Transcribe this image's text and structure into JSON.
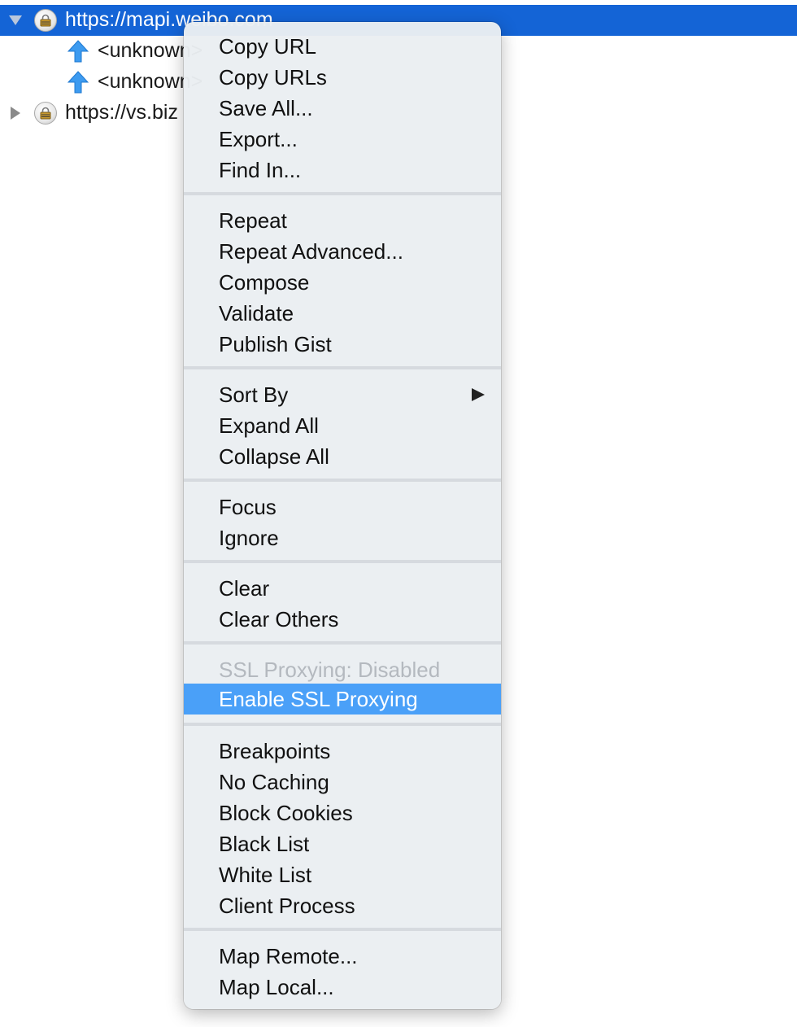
{
  "tree": {
    "rows": [
      {
        "label": "https://mapi.weibo.com"
      },
      {
        "label": "<unknown>"
      },
      {
        "label": "<unknown>"
      },
      {
        "label": "https://vs.biz"
      }
    ]
  },
  "menu": {
    "groups": [
      {
        "items": [
          "Copy URL",
          "Copy URLs",
          "Save All...",
          "Export...",
          "Find In..."
        ]
      },
      {
        "items": [
          "Repeat",
          "Repeat Advanced...",
          "Compose",
          "Validate",
          "Publish Gist"
        ]
      },
      {
        "items": [
          "Sort By",
          "Expand All",
          "Collapse All"
        ]
      },
      {
        "items": [
          "Focus",
          "Ignore"
        ]
      },
      {
        "items": [
          "Clear",
          "Clear Others"
        ]
      },
      {
        "items": [
          "SSL Proxying: Disabled",
          "Enable SSL Proxying"
        ]
      },
      {
        "items": [
          "Breakpoints",
          "No Caching",
          "Block Cookies",
          "Black List",
          "White List",
          "Client Process"
        ]
      },
      {
        "items": [
          "Map Remote...",
          "Map Local..."
        ]
      }
    ],
    "disabled_item": "SSL Proxying: Disabled",
    "highlighted_item": "Enable SSL Proxying",
    "submenu_item": "Sort By"
  },
  "colors": {
    "selection": "#1464d6",
    "menu_highlight": "#4aa0f8",
    "upload_arrow": "#3d9bf0"
  }
}
